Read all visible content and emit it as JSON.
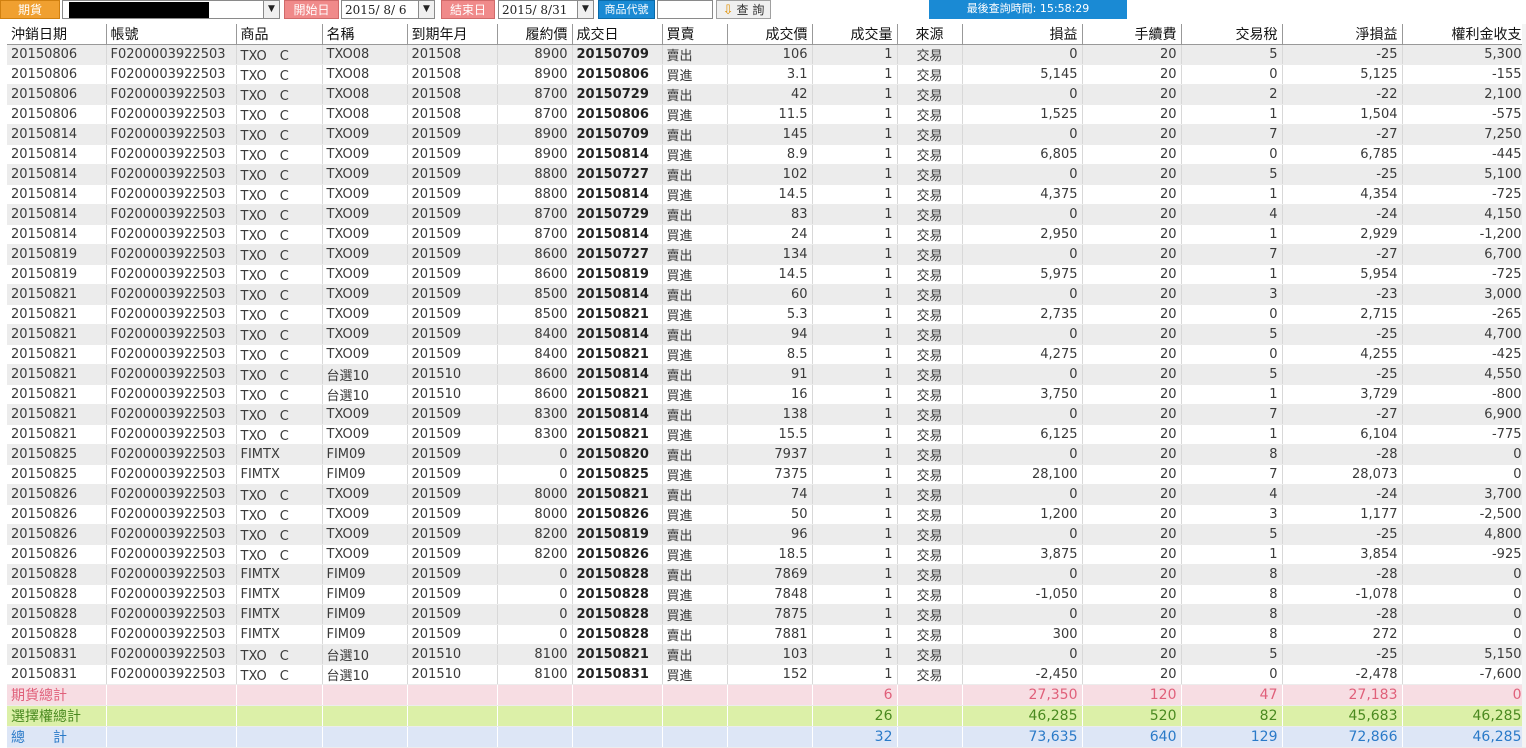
{
  "toolbar": {
    "market_label": "期貨",
    "start_label": "開始日",
    "start_date": "2015/ 8/ 6",
    "end_label": "結束日",
    "end_date": "2015/ 8/31",
    "product_label": "商品代號",
    "query_button": "查 詢",
    "last_query_time": "最後查詢時間: 15:58:29"
  },
  "columns": [
    "沖銷日期",
    "帳號",
    "商品",
    "名稱",
    "到期年月",
    "履約價",
    "成交日",
    "買賣",
    "成交價",
    "成交量",
    "來源",
    "損益",
    "手續費",
    "交易稅",
    "淨損益",
    "權利金收支"
  ],
  "rows": [
    [
      "20150806",
      "F0200003922503",
      "TXO　C",
      "TXO08",
      "201508",
      "8900",
      "20150709",
      "賣出",
      "106",
      "1",
      "交易",
      "0",
      "20",
      "5",
      "-25",
      "5,300"
    ],
    [
      "20150806",
      "F0200003922503",
      "TXO　C",
      "TXO08",
      "201508",
      "8900",
      "20150806",
      "買進",
      "3.1",
      "1",
      "交易",
      "5,145",
      "20",
      "0",
      "5,125",
      "-155"
    ],
    [
      "20150806",
      "F0200003922503",
      "TXO　C",
      "TXO08",
      "201508",
      "8700",
      "20150729",
      "賣出",
      "42",
      "1",
      "交易",
      "0",
      "20",
      "2",
      "-22",
      "2,100"
    ],
    [
      "20150806",
      "F0200003922503",
      "TXO　C",
      "TXO08",
      "201508",
      "8700",
      "20150806",
      "買進",
      "11.5",
      "1",
      "交易",
      "1,525",
      "20",
      "1",
      "1,504",
      "-575"
    ],
    [
      "20150814",
      "F0200003922503",
      "TXO　C",
      "TXO09",
      "201509",
      "8900",
      "20150709",
      "賣出",
      "145",
      "1",
      "交易",
      "0",
      "20",
      "7",
      "-27",
      "7,250"
    ],
    [
      "20150814",
      "F0200003922503",
      "TXO　C",
      "TXO09",
      "201509",
      "8900",
      "20150814",
      "買進",
      "8.9",
      "1",
      "交易",
      "6,805",
      "20",
      "0",
      "6,785",
      "-445"
    ],
    [
      "20150814",
      "F0200003922503",
      "TXO　C",
      "TXO09",
      "201509",
      "8800",
      "20150727",
      "賣出",
      "102",
      "1",
      "交易",
      "0",
      "20",
      "5",
      "-25",
      "5,100"
    ],
    [
      "20150814",
      "F0200003922503",
      "TXO　C",
      "TXO09",
      "201509",
      "8800",
      "20150814",
      "買進",
      "14.5",
      "1",
      "交易",
      "4,375",
      "20",
      "1",
      "4,354",
      "-725"
    ],
    [
      "20150814",
      "F0200003922503",
      "TXO　C",
      "TXO09",
      "201509",
      "8700",
      "20150729",
      "賣出",
      "83",
      "1",
      "交易",
      "0",
      "20",
      "4",
      "-24",
      "4,150"
    ],
    [
      "20150814",
      "F0200003922503",
      "TXO　C",
      "TXO09",
      "201509",
      "8700",
      "20150814",
      "買進",
      "24",
      "1",
      "交易",
      "2,950",
      "20",
      "1",
      "2,929",
      "-1,200"
    ],
    [
      "20150819",
      "F0200003922503",
      "TXO　C",
      "TXO09",
      "201509",
      "8600",
      "20150727",
      "賣出",
      "134",
      "1",
      "交易",
      "0",
      "20",
      "7",
      "-27",
      "6,700"
    ],
    [
      "20150819",
      "F0200003922503",
      "TXO　C",
      "TXO09",
      "201509",
      "8600",
      "20150819",
      "買進",
      "14.5",
      "1",
      "交易",
      "5,975",
      "20",
      "1",
      "5,954",
      "-725"
    ],
    [
      "20150821",
      "F0200003922503",
      "TXO　C",
      "TXO09",
      "201509",
      "8500",
      "20150814",
      "賣出",
      "60",
      "1",
      "交易",
      "0",
      "20",
      "3",
      "-23",
      "3,000"
    ],
    [
      "20150821",
      "F0200003922503",
      "TXO　C",
      "TXO09",
      "201509",
      "8500",
      "20150821",
      "買進",
      "5.3",
      "1",
      "交易",
      "2,735",
      "20",
      "0",
      "2,715",
      "-265"
    ],
    [
      "20150821",
      "F0200003922503",
      "TXO　C",
      "TXO09",
      "201509",
      "8400",
      "20150814",
      "賣出",
      "94",
      "1",
      "交易",
      "0",
      "20",
      "5",
      "-25",
      "4,700"
    ],
    [
      "20150821",
      "F0200003922503",
      "TXO　C",
      "TXO09",
      "201509",
      "8400",
      "20150821",
      "買進",
      "8.5",
      "1",
      "交易",
      "4,275",
      "20",
      "0",
      "4,255",
      "-425"
    ],
    [
      "20150821",
      "F0200003922503",
      "TXO　C",
      "台選10",
      "201510",
      "8600",
      "20150814",
      "賣出",
      "91",
      "1",
      "交易",
      "0",
      "20",
      "5",
      "-25",
      "4,550"
    ],
    [
      "20150821",
      "F0200003922503",
      "TXO　C",
      "台選10",
      "201510",
      "8600",
      "20150821",
      "買進",
      "16",
      "1",
      "交易",
      "3,750",
      "20",
      "1",
      "3,729",
      "-800"
    ],
    [
      "20150821",
      "F0200003922503",
      "TXO　C",
      "TXO09",
      "201509",
      "8300",
      "20150814",
      "賣出",
      "138",
      "1",
      "交易",
      "0",
      "20",
      "7",
      "-27",
      "6,900"
    ],
    [
      "20150821",
      "F0200003922503",
      "TXO　C",
      "TXO09",
      "201509",
      "8300",
      "20150821",
      "買進",
      "15.5",
      "1",
      "交易",
      "6,125",
      "20",
      "1",
      "6,104",
      "-775"
    ],
    [
      "20150825",
      "F0200003922503",
      "FIMTX",
      "FIM09",
      "201509",
      "0",
      "20150820",
      "賣出",
      "7937",
      "1",
      "交易",
      "0",
      "20",
      "8",
      "-28",
      "0"
    ],
    [
      "20150825",
      "F0200003922503",
      "FIMTX",
      "FIM09",
      "201509",
      "0",
      "20150825",
      "買進",
      "7375",
      "1",
      "交易",
      "28,100",
      "20",
      "7",
      "28,073",
      "0"
    ],
    [
      "20150826",
      "F0200003922503",
      "TXO　C",
      "TXO09",
      "201509",
      "8000",
      "20150821",
      "賣出",
      "74",
      "1",
      "交易",
      "0",
      "20",
      "4",
      "-24",
      "3,700"
    ],
    [
      "20150826",
      "F0200003922503",
      "TXO　C",
      "TXO09",
      "201509",
      "8000",
      "20150826",
      "買進",
      "50",
      "1",
      "交易",
      "1,200",
      "20",
      "3",
      "1,177",
      "-2,500"
    ],
    [
      "20150826",
      "F0200003922503",
      "TXO　C",
      "TXO09",
      "201509",
      "8200",
      "20150819",
      "賣出",
      "96",
      "1",
      "交易",
      "0",
      "20",
      "5",
      "-25",
      "4,800"
    ],
    [
      "20150826",
      "F0200003922503",
      "TXO　C",
      "TXO09",
      "201509",
      "8200",
      "20150826",
      "買進",
      "18.5",
      "1",
      "交易",
      "3,875",
      "20",
      "1",
      "3,854",
      "-925"
    ],
    [
      "20150828",
      "F0200003922503",
      "FIMTX",
      "FIM09",
      "201509",
      "0",
      "20150828",
      "賣出",
      "7869",
      "1",
      "交易",
      "0",
      "20",
      "8",
      "-28",
      "0"
    ],
    [
      "20150828",
      "F0200003922503",
      "FIMTX",
      "FIM09",
      "201509",
      "0",
      "20150828",
      "買進",
      "7848",
      "1",
      "交易",
      "-1,050",
      "20",
      "8",
      "-1,078",
      "0"
    ],
    [
      "20150828",
      "F0200003922503",
      "FIMTX",
      "FIM09",
      "201509",
      "0",
      "20150828",
      "買進",
      "7875",
      "1",
      "交易",
      "0",
      "20",
      "8",
      "-28",
      "0"
    ],
    [
      "20150828",
      "F0200003922503",
      "FIMTX",
      "FIM09",
      "201509",
      "0",
      "20150828",
      "賣出",
      "7881",
      "1",
      "交易",
      "300",
      "20",
      "8",
      "272",
      "0"
    ],
    [
      "20150831",
      "F0200003922503",
      "TXO　C",
      "台選10",
      "201510",
      "8100",
      "20150821",
      "賣出",
      "103",
      "1",
      "交易",
      "0",
      "20",
      "5",
      "-25",
      "5,150"
    ],
    [
      "20150831",
      "F0200003922503",
      "TXO　C",
      "台選10",
      "201510",
      "8100",
      "20150831",
      "買進",
      "152",
      "1",
      "交易",
      "-2,450",
      "20",
      "0",
      "-2,478",
      "-7,600"
    ]
  ],
  "totals": [
    {
      "label": "期貨總計",
      "qty": "6",
      "pnl": "27,350",
      "fee": "120",
      "tax": "47",
      "net": "27,183",
      "premium": "0"
    },
    {
      "label": "選擇權總計",
      "qty": "26",
      "pnl": "46,285",
      "fee": "520",
      "tax": "82",
      "net": "45,683",
      "premium": "46,285"
    },
    {
      "label": "總　　計",
      "qty": "32",
      "pnl": "73,635",
      "fee": "640",
      "tax": "129",
      "net": "72,866",
      "premium": "46,285"
    }
  ],
  "colors": {
    "futures_total": "#f7dde3",
    "options_total": "#dcf0a8",
    "grand_total": "#dde6f6",
    "accent_orange": "#f0a030",
    "accent_blue": "#1a8ad4"
  }
}
